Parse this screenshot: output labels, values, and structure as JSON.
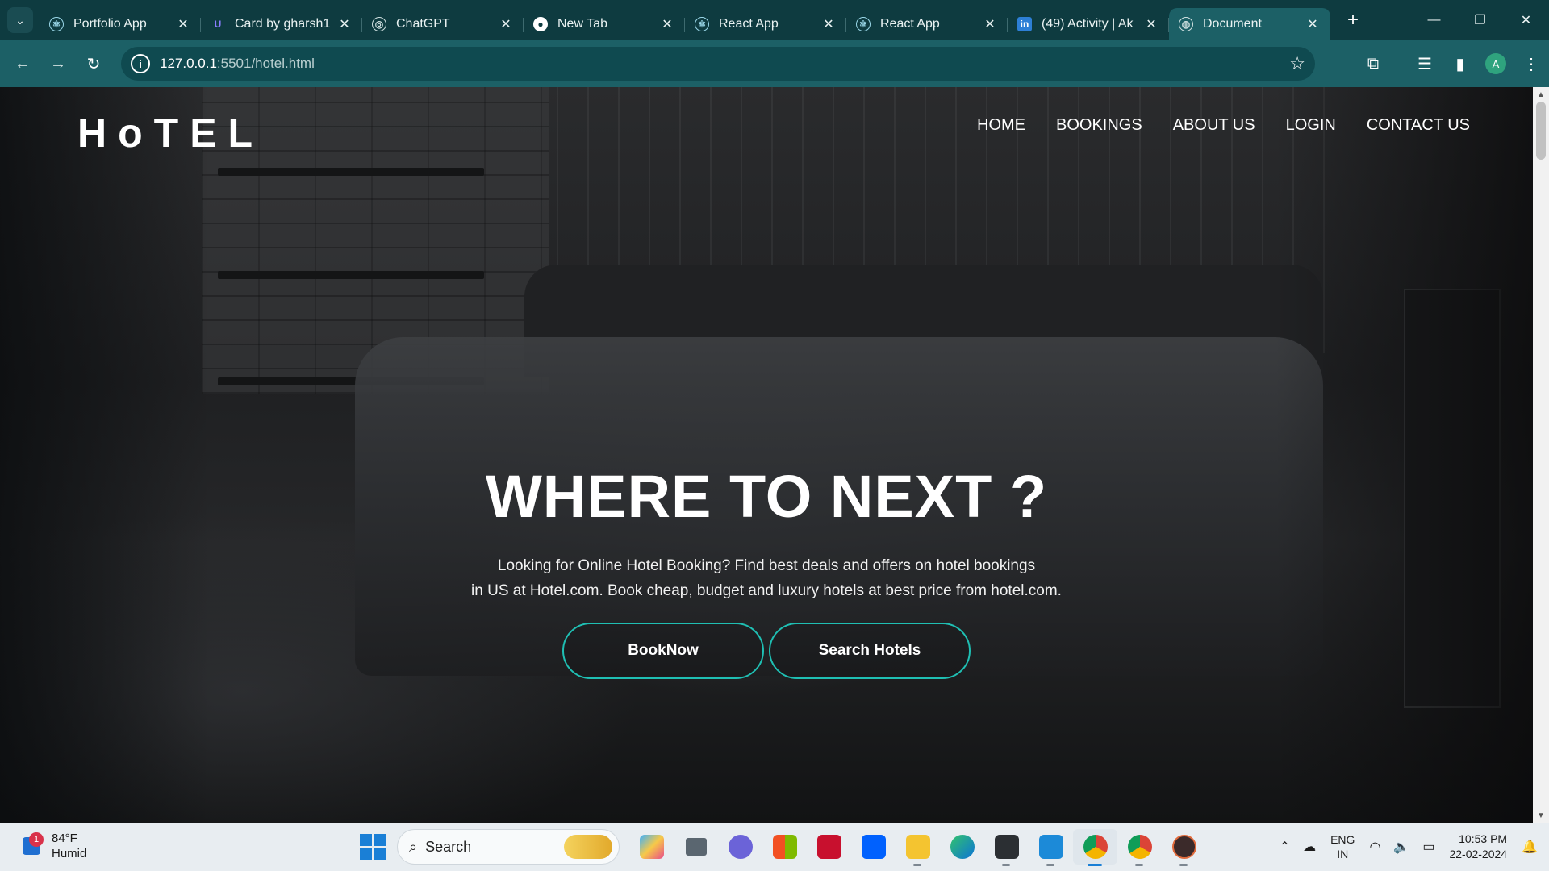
{
  "browser": {
    "tabs": [
      {
        "title": "Portfolio App",
        "icon": "react-icon",
        "active": false
      },
      {
        "title": "Card by gharsh1",
        "icon": "uiverse-icon",
        "active": false
      },
      {
        "title": "ChatGPT",
        "icon": "chatgpt-icon",
        "active": false
      },
      {
        "title": "New Tab",
        "icon": "chrome-icon",
        "active": false
      },
      {
        "title": "React App",
        "icon": "react-icon",
        "active": false
      },
      {
        "title": "React App",
        "icon": "react-icon",
        "active": false
      },
      {
        "title": "(49) Activity | Ak",
        "icon": "linkedin-icon",
        "active": false
      },
      {
        "title": "Document",
        "icon": "globe-icon",
        "active": true
      }
    ],
    "url_host": "127.0.0.1",
    "url_rest": ":5501/hotel.html",
    "profile_initial": "A"
  },
  "site": {
    "logo": "HoTEL",
    "nav": [
      "HOME",
      "BOOKINGS",
      "ABOUT US",
      "LOGIN",
      "CONTACT US"
    ],
    "hero_title": "WHERE TO NEXT ?",
    "hero_line1": "Looking for Online Hotel Booking? Find best deals and offers on hotel bookings",
    "hero_line2": "in US at Hotel.com. Book cheap, budget and luxury hotels at best price from hotel.com.",
    "btn_book": "BookNow",
    "btn_search": "Search Hotels",
    "accent_color": "#1fbfb3"
  },
  "taskbar": {
    "weather_badge": "1",
    "weather_temp": "84°F",
    "weather_desc": "Humid",
    "search_label": "Search",
    "lang_line1": "ENG",
    "lang_line2": "IN",
    "time": "10:53 PM",
    "date": "22-02-2024"
  }
}
